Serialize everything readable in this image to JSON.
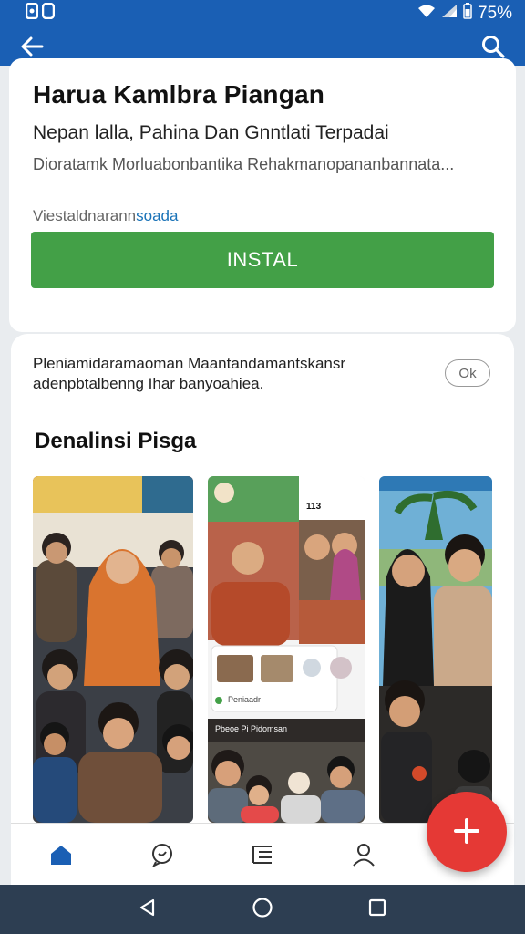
{
  "status_bar": {
    "left_icons": [
      "sim-icon",
      "sync-icon"
    ],
    "battery": "75%",
    "colors": {
      "bg": "#1a5fb4",
      "fg": "#ffffff"
    }
  },
  "app_bar": {
    "icons": [
      "back-arrow-icon",
      "search-icon"
    ]
  },
  "app": {
    "title": "Harua Kamlbra Piangan",
    "subtitle": "Nepan lalla, Pahina Dan Gnntlati Terpadai",
    "description": "Dioratamk Morluabonbantika Rehakmanopananbannata...",
    "meta_prefix": "Viestaldnarann",
    "meta_link": "soada",
    "install_label": "INSTAL",
    "install_color": "#43a047"
  },
  "notice": {
    "text": "Pleniamidaramaoman Maantandamantskansr adenpbtalbenng Ihar banyoahiea.",
    "ok_label": "Ok"
  },
  "screenshots": {
    "title": "Denalinsi Pisga",
    "phone_time": "113",
    "phone_card_label": "Peniaadr",
    "banner_text": "Pbeoe Pi Pidomsan"
  },
  "bottom_nav": {
    "items": [
      "home-icon",
      "chat-icon",
      "list-icon",
      "profile-icon"
    ]
  },
  "fab": {
    "icon": "plus-icon",
    "color": "#e53935"
  },
  "system_nav": {
    "items": [
      "back-triangle-icon",
      "home-circle-icon",
      "recents-square-icon"
    ]
  }
}
